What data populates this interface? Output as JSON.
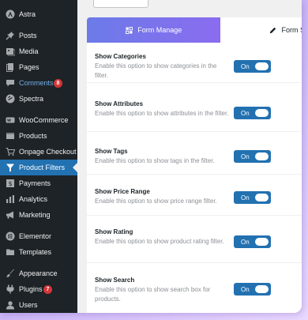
{
  "sidebar": {
    "items": [
      {
        "label": "Astra",
        "icon": "astra-icon"
      },
      {
        "label": "Posts",
        "icon": "pin-icon"
      },
      {
        "label": "Media",
        "icon": "media-icon"
      },
      {
        "label": "Pages",
        "icon": "pages-icon"
      },
      {
        "label": "Comments",
        "icon": "comment-icon",
        "badge": "8"
      },
      {
        "label": "Spectra",
        "icon": "spectra-icon"
      },
      {
        "label": "WooCommerce",
        "icon": "woocommerce-icon"
      },
      {
        "label": "Products",
        "icon": "products-icon"
      },
      {
        "label": "Onpage Checkout",
        "icon": "cart-icon"
      },
      {
        "label": "Product Filters",
        "icon": "filter-icon"
      },
      {
        "label": "Payments",
        "icon": "payments-icon"
      },
      {
        "label": "Analytics",
        "icon": "analytics-icon"
      },
      {
        "label": "Marketing",
        "icon": "megaphone-icon"
      },
      {
        "label": "Elementor",
        "icon": "elementor-icon"
      },
      {
        "label": "Templates",
        "icon": "folder-icon"
      },
      {
        "label": "Appearance",
        "icon": "brush-icon"
      },
      {
        "label": "Plugins",
        "icon": "plugin-icon",
        "badge": "7"
      },
      {
        "label": "Users",
        "icon": "user-icon"
      }
    ]
  },
  "tabs": {
    "active_label": "Form Manage",
    "inactive_label": "Form Style"
  },
  "settings": [
    {
      "title": "Show Categories",
      "desc": "Enable this option to show categories in the filter.",
      "toggle": "On"
    },
    {
      "title": "Show Attributes",
      "desc": "Enable this option to show attributes in the filter.",
      "toggle": "On"
    },
    {
      "title": "Show Tags",
      "desc": "Enable this option to show tags in the filter.",
      "toggle": "On"
    },
    {
      "title": "Show Price Range",
      "desc": "Enable this option to show price range filter.",
      "toggle": "On"
    },
    {
      "title": "Show Rating",
      "desc": "Enable this option to show product rating filter.",
      "toggle": "On"
    },
    {
      "title": "Show Search",
      "desc": "Enable this option to show search box for products.",
      "toggle": "On"
    }
  ],
  "colors": {
    "sidebar_bg": "#1d2327",
    "accent": "#2271b1",
    "tab_gradient_start": "#6c7be8",
    "tab_gradient_end": "#8a6cf0",
    "badge": "#d63638"
  }
}
